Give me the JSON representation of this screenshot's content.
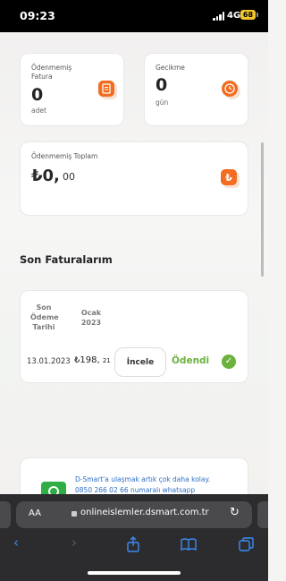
{
  "status_bar": {
    "time": "09:23",
    "network": "4G",
    "battery": "68"
  },
  "summary": {
    "unpaid_invoices": {
      "label_line1": "Ödenmemiş",
      "label_line2": "Fatura",
      "value": "0",
      "unit": "adet",
      "icon": "invoice-icon"
    },
    "delay": {
      "label": "Gecikme",
      "value": "0",
      "unit": "gün",
      "icon": "clock-icon"
    },
    "unpaid_total": {
      "label": "Ödenmemiş Toplam",
      "currency": "₺",
      "main": "0,",
      "decimals": "00",
      "icon": "lira-icon"
    }
  },
  "invoices": {
    "title": "Son Faturalarım",
    "headers": {
      "due_line1": "Son",
      "due_line2": "Ödeme",
      "due_line3": "Tarihi",
      "period_line1": "Ocak",
      "period_line2": "2023"
    },
    "rows": [
      {
        "date": "13.01.2023",
        "amount_main": "₺198,",
        "amount_decimals": "21",
        "button": "İncele",
        "status": "Ödendi",
        "status_icon": "check-icon"
      }
    ]
  },
  "promo": {
    "line1": "D-Smart'a ulaşmak artık çok daha kolay.",
    "line2": "0850 266 02 66 numaralı whatsapp",
    "icon": "whatsapp-icon"
  },
  "browser": {
    "text_size": "AA",
    "url": "onlineislemler.dsmart.com.tr"
  },
  "colors": {
    "accent_orange": "#f26d21",
    "paid_green": "#6ab23c",
    "link_blue": "#2f6fc3",
    "safari_blue": "#3b8cf5"
  }
}
